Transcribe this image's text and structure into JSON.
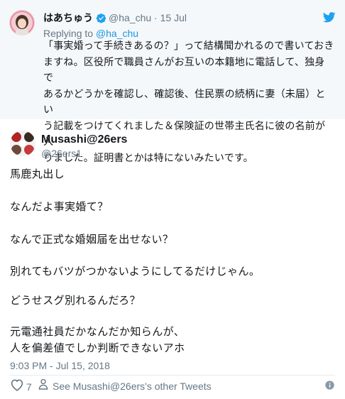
{
  "parent_tweet": {
    "display_name": "はあちゅう",
    "handle": "@ha_chu",
    "separator": "·",
    "date": "15 Jul",
    "replying_prefix": "Replying to",
    "replying_to": "@ha_chu",
    "text_lines": [
      "「事実婚って手続きあるの？」って結構聞かれるので書いておき",
      "ますね。区役所で職員さんがお互いの本籍地に電話して、独身で",
      "あるかどうかを確認し、確認後、住民票の続柄に妻（未届）とい",
      "う記載をつけてくれました＆保険証の世帯主氏名に彼の名前が入",
      "りました。証明書とかは特にないみたいです。"
    ]
  },
  "main_tweet": {
    "display_name": "Musashi@26ers",
    "handle": "@26ers1",
    "lines": [
      "馬鹿丸出し",
      "なんだよ事実婚て？",
      "なんで正式な婚姻届を出せない？",
      "別れてもバツがつかないようにしてるだけじゃん。",
      "どうせスグ別れるんだろ？",
      "元電通社員だかなんだか知らんが、",
      "人を偏差値でしか判断できないアホ"
    ],
    "timestamp": "9:03 PM - Jul 15, 2018",
    "like_count": "7",
    "other_tweets_label": "See Musashi@26ers's other Tweets"
  },
  "icons": {
    "brand": "twitter-bird-icon",
    "verified": "verified-badge-icon",
    "like": "heart-icon",
    "profile": "person-icon",
    "info": "info-icon"
  },
  "colors": {
    "brand_blue": "#1da1f2",
    "link_blue": "#1b95e0",
    "muted": "#657786",
    "text": "#14171a",
    "parent_bg": "#f5f8fa"
  }
}
